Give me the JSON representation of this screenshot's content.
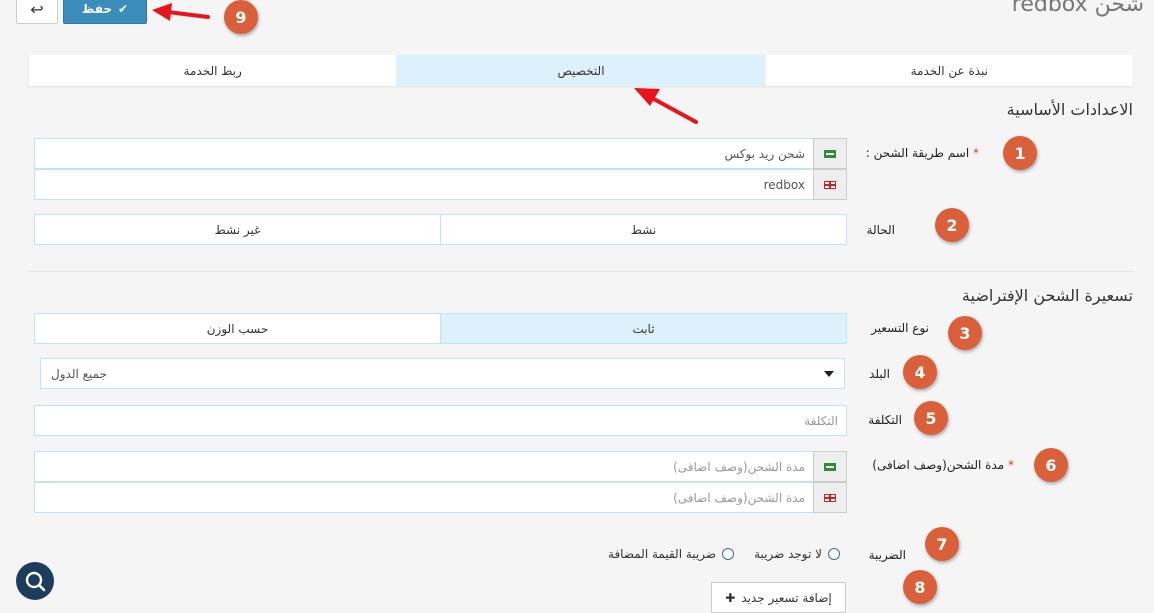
{
  "header": {
    "title": "شحن redbox",
    "save_label": "حفظ",
    "back_icon": "reply-arrow-icon"
  },
  "tabs": [
    {
      "label": "نبذة عن الخدمة"
    },
    {
      "label": "التخصيص",
      "active": true
    },
    {
      "label": "ربط الخدمة"
    }
  ],
  "basic_settings": {
    "title": "الاعدادات الأساسية",
    "shipping_name_label": "اسم طريقة الشحن :",
    "shipping_name_ar": "شحن ريد بوكس",
    "shipping_name_en": "redbox",
    "status_label": "الحالة",
    "status_options": [
      "نشط",
      "غير نشط"
    ]
  },
  "default_pricing": {
    "title": "تسعيرة الشحن الإفتراضية",
    "pricing_type_label": "نوع التسعير",
    "pricing_options": [
      "ثابت",
      "حسب الوزن"
    ],
    "selected_pricing": "ثابت",
    "country_label": "البلد",
    "country_value": "جميع الدول",
    "cost_label": "التكلفة",
    "cost_placeholder": "التكلفة",
    "duration_label": "مدة الشحن(وصف اضافى)",
    "duration_placeholder_ar": "مدة الشحن(وصف اضافى)",
    "duration_placeholder_en": "مدة الشحن(وصف اضافى)",
    "tax_label": "الضريبة",
    "tax_options": [
      "ضريبة القيمة المضافة",
      "لا توجد ضريبة"
    ],
    "add_pricing_label": "إضافة تسعير جديد"
  },
  "annotations": [
    "1",
    "2",
    "3",
    "4",
    "5",
    "6",
    "7",
    "8",
    "9"
  ],
  "colors": {
    "primary": "#3c8dbc",
    "active_tab": "#dcf1fb",
    "badge": "#d9603b",
    "arrow": "#e8131b"
  }
}
